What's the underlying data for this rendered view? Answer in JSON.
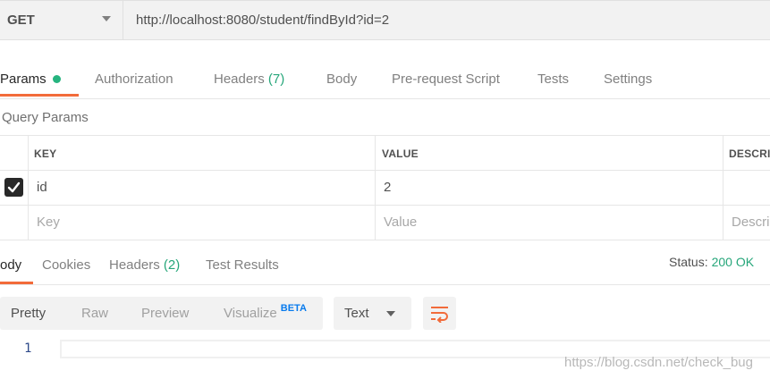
{
  "request": {
    "method": "GET",
    "url": "http://localhost:8080/student/findById?id=2"
  },
  "request_tabs": {
    "params": "Params",
    "authorization": "Authorization",
    "headers": "Headers",
    "headers_count": "(7)",
    "body": "Body",
    "prerequest": "Pre-request Script",
    "tests": "Tests",
    "settings": "Settings"
  },
  "query_params": {
    "title": "Query Params",
    "columns": {
      "key": "KEY",
      "value": "VALUE",
      "description": "DESCRI"
    },
    "rows": [
      {
        "checked": true,
        "key": "id",
        "value": "2"
      }
    ],
    "placeholders": {
      "key": "Key",
      "value": "Value",
      "description": "Descri"
    }
  },
  "response_tabs": {
    "body": "ody",
    "cookies": "Cookies",
    "headers": "Headers",
    "headers_count": "(2)",
    "test_results": "Test Results"
  },
  "status": {
    "label": "Status:",
    "value": "200 OK"
  },
  "view_modes": {
    "pretty": "Pretty",
    "raw": "Raw",
    "preview": "Preview",
    "visualize": "Visualize",
    "beta": "BETA"
  },
  "format": {
    "selected": "Text"
  },
  "editor": {
    "line_numbers": [
      "1"
    ]
  },
  "watermark": "https://blog.csdn.net/check_bug",
  "colors": {
    "accent": "#f26b3a",
    "success": "#26a67a",
    "beta": "#097bed"
  }
}
